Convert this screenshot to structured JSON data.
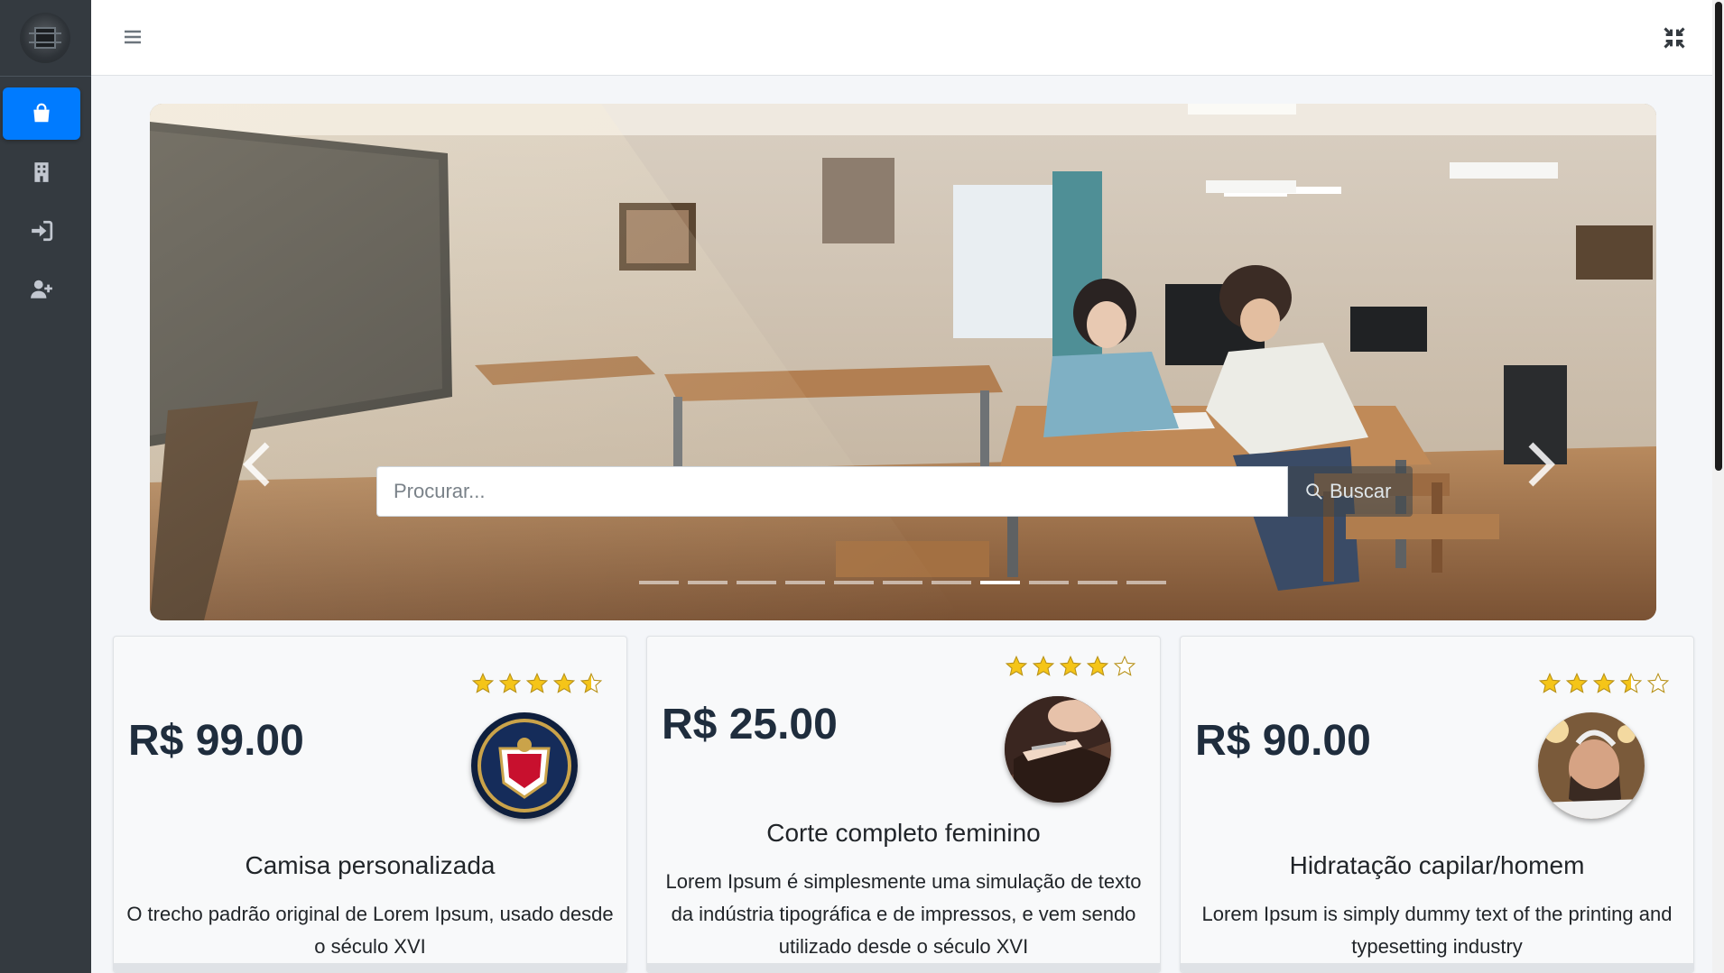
{
  "search": {
    "placeholder": "Procurar...",
    "button_label": "Buscar"
  },
  "carousel": {
    "slide_count": 11,
    "active_index": 7
  },
  "cards": [
    {
      "price": "R$ 99.00",
      "title": "Camisa personalizada",
      "description": "O trecho padrão original de Lorem Ipsum, usado desde o século XVI",
      "rating": 4.5
    },
    {
      "price": "R$ 25.00",
      "title": "Corte completo feminino",
      "description": "Lorem Ipsum é simplesmente uma simulação de texto da indústria tipográfica e de impressos, e vem sendo utilizado desde o século XVI",
      "rating": 4
    },
    {
      "price": "R$ 90.00",
      "title": "Hidratação capilar/homem",
      "description": "Lorem Ipsum is simply dummy text of the printing and typesetting industry",
      "rating": 3.5
    }
  ],
  "colors": {
    "sidebar": "#343a40",
    "accent": "#007bff",
    "star": "#f5c518"
  },
  "icons": {
    "sidebar": [
      "shopping-bag-icon",
      "building-icon",
      "sign-in-icon",
      "user-plus-icon"
    ],
    "topbar": [
      "menu-icon",
      "compress-icon"
    ]
  }
}
